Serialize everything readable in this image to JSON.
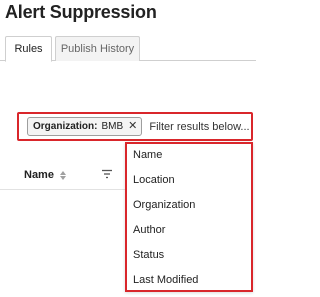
{
  "page": {
    "title": "Alert Suppression"
  },
  "tabs": [
    {
      "label": "Rules",
      "active": true
    },
    {
      "label": "Publish History",
      "active": false
    }
  ],
  "filter": {
    "chip": {
      "key": "Organization:",
      "value": "BMB",
      "close_icon": "close-icon"
    },
    "input_placeholder": "Filter results below..."
  },
  "table": {
    "columns": [
      {
        "label": "Name",
        "sort_icon": "sort-icon"
      }
    ]
  },
  "dropdown": {
    "items": [
      "Name",
      "Location",
      "Organization",
      "Author",
      "Status",
      "Last Modified"
    ]
  },
  "colors": {
    "highlight": "#d9262b",
    "tab_inactive_bg": "#f3f3f3"
  }
}
